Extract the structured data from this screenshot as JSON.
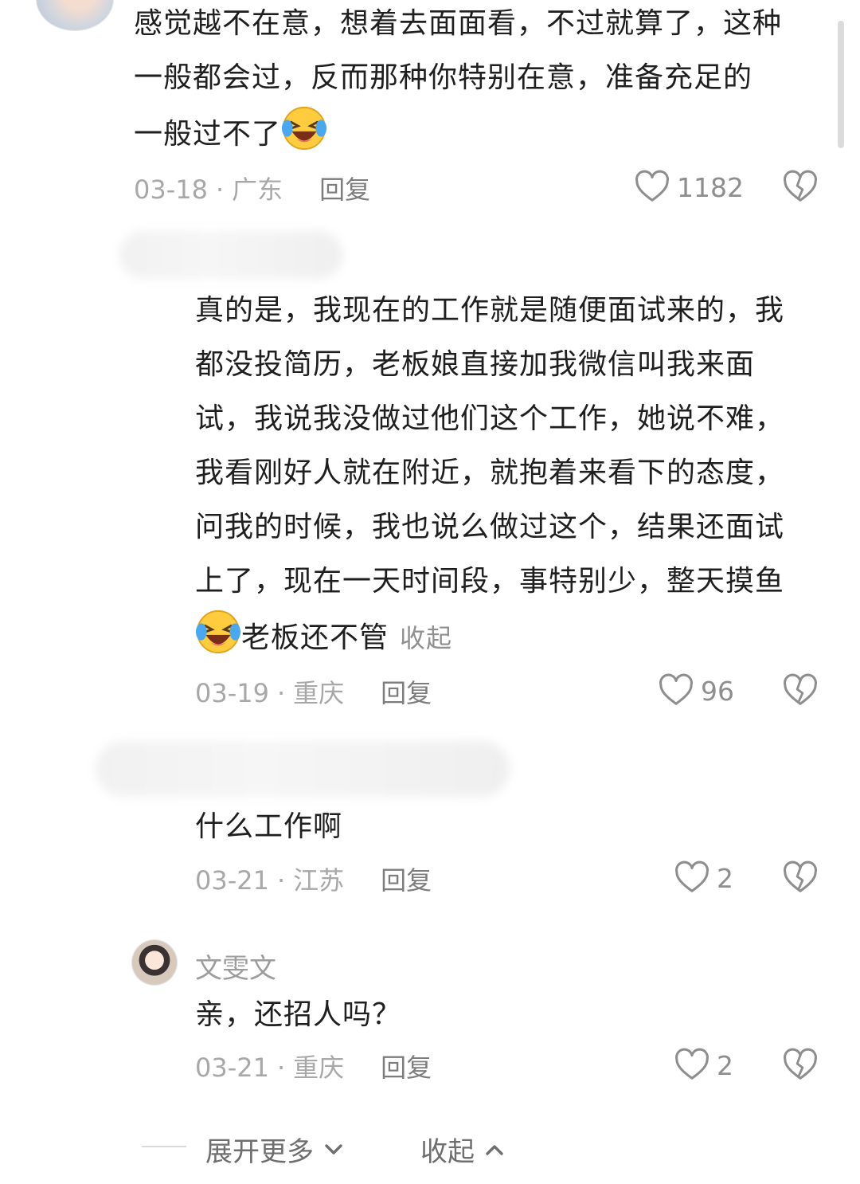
{
  "comments": [
    {
      "text_lines": [
        "感觉越不在意，想着去面面看，不过就算了，这种",
        "一般都会过，反而那种你特别在意，准备充足的",
        "一般过不了"
      ],
      "emoji": "grinning-squint-tears-emoji",
      "date": "03-18",
      "location": "广东",
      "reply_label": "回复",
      "likes": "1182"
    },
    {
      "text_lines": [
        "真的是，我现在的工作就是随便面试来的，我",
        "都没投简历，老板娘直接加我微信叫我来面",
        "试，我说我没做过他们这个工作，她说不难，",
        "我看刚好人就在附近，就抱着来看下的态度，",
        "问我的时候，我也说么做过这个，结果还面试",
        "上了，现在一天时间段，事特别少，整天摸鱼",
        "老板还不管"
      ],
      "emoji": "grinning-squint-tears-emoji",
      "collapse_label": "收起",
      "date": "03-19",
      "location": "重庆",
      "reply_label": "回复",
      "likes": "96"
    },
    {
      "text_lines": [
        "什么工作啊"
      ],
      "date": "03-21",
      "location": "江苏",
      "reply_label": "回复",
      "likes": "2"
    },
    {
      "username": "文雯文",
      "text_lines": [
        "亲，还招人吗？"
      ],
      "date": "03-21",
      "location": "重庆",
      "reply_label": "回复",
      "likes": "2"
    }
  ],
  "footer": {
    "expand_label": "展开更多",
    "collapse_label": "收起"
  },
  "colors": {
    "text": "#1f1f1f",
    "meta": "#a8a8a8",
    "icon": "#8e8e8e"
  }
}
